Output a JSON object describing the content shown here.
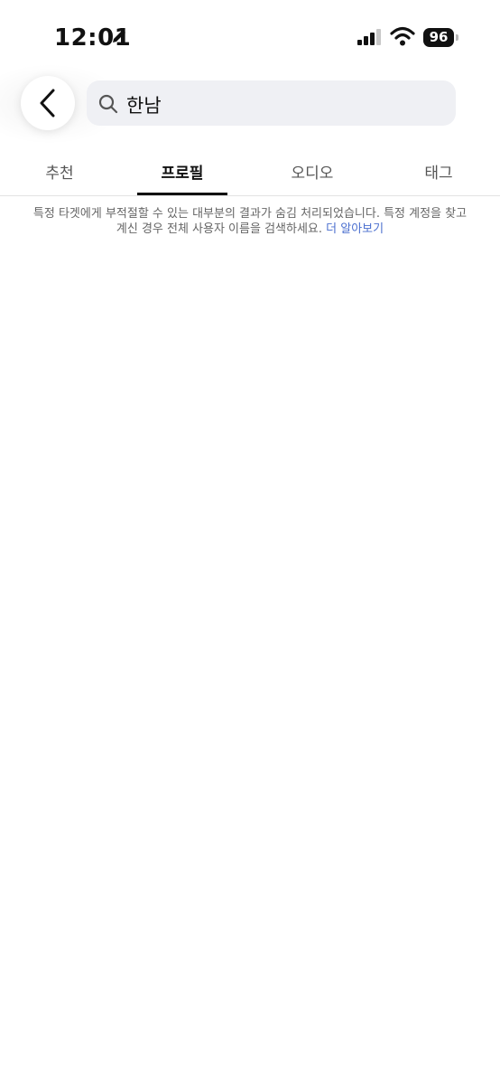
{
  "status_bar": {
    "time": "12:01",
    "battery": "96",
    "icons": [
      "pencil-icon",
      "signal-icon",
      "wifi-icon",
      "battery-icon"
    ]
  },
  "search": {
    "value": "한남"
  },
  "tabs": [
    {
      "label": "추천",
      "active": false
    },
    {
      "label": "프로필",
      "active": true
    },
    {
      "label": "오디오",
      "active": false
    },
    {
      "label": "태그",
      "active": false
    }
  ],
  "notice": {
    "text": "특정 타겟에게 부적절할 수 있는 대부분의 결과가 숨김 처리되었습니다. 특정 계정을 찾고 계신 경우 전체 사용자 이름을 검색하세요.",
    "link": "더 알아보기"
  },
  "colors": {
    "link": "#4b6fcf",
    "search_bg": "#eff0f4",
    "active_indicator": "#111111"
  }
}
